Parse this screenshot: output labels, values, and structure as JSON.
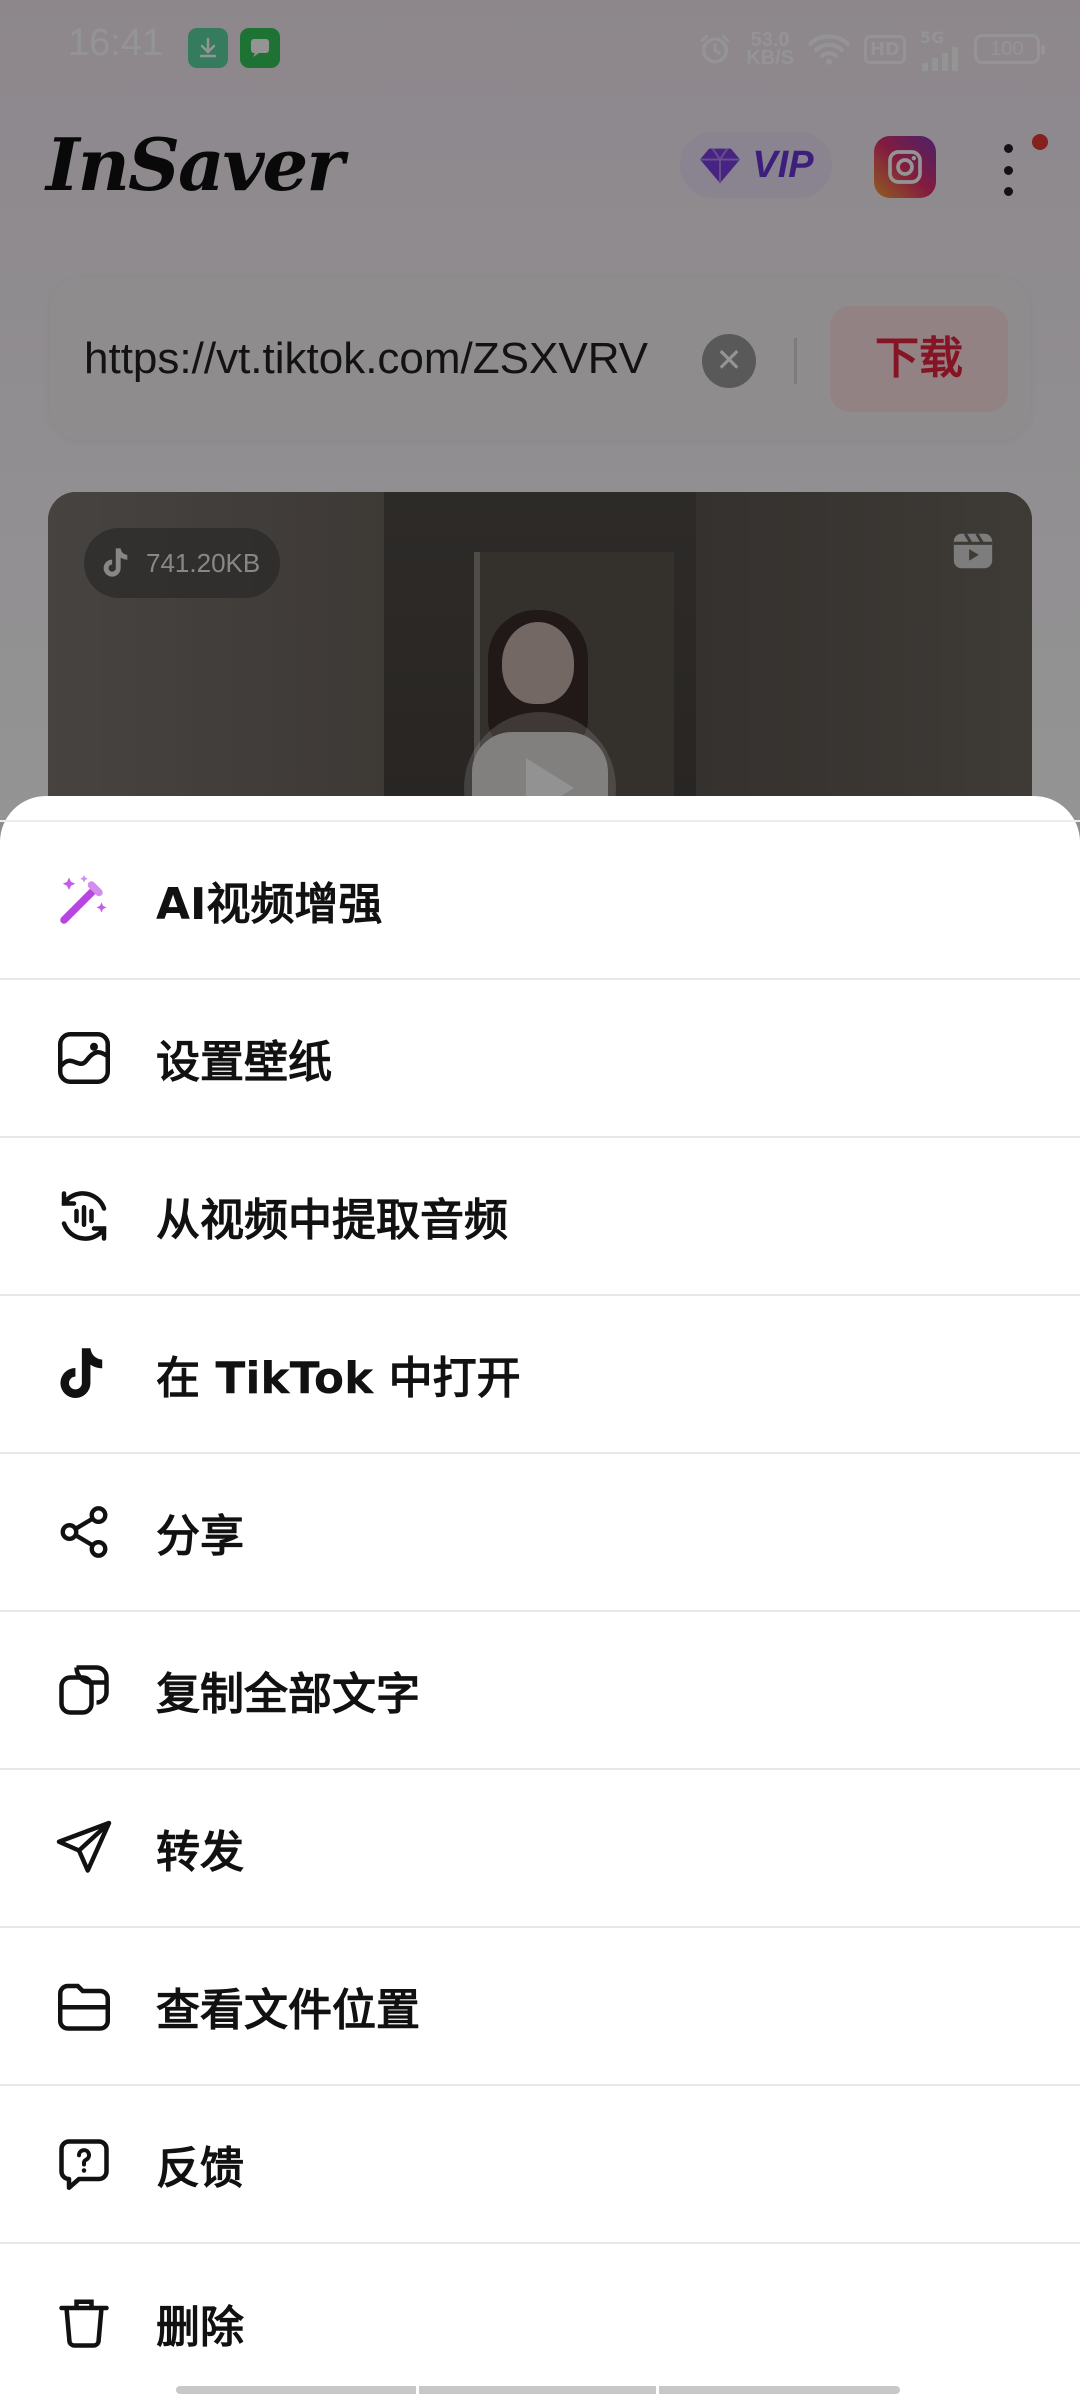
{
  "status_bar": {
    "time": "16:41",
    "speed_value": "53.0",
    "speed_unit": "KB/S",
    "hd_label": "HD",
    "network_label": "5G",
    "battery": "100"
  },
  "header": {
    "logo": "InSaver",
    "vip_label": "VIP"
  },
  "url_bar": {
    "url": "https://vt.tiktok.com/ZSXVRV",
    "download_label": "下载"
  },
  "video_card": {
    "file_size": "741.20KB"
  },
  "menu": {
    "items": [
      {
        "label": "AI视频增强",
        "icon": "magic-wand-icon"
      },
      {
        "label": "设置壁纸",
        "icon": "wallpaper-icon"
      },
      {
        "label": "从视频中提取音频",
        "icon": "extract-audio-icon"
      },
      {
        "label": "在 TikTok 中打开",
        "icon": "tiktok-icon"
      },
      {
        "label": "分享",
        "icon": "share-icon"
      },
      {
        "label": "复制全部文字",
        "icon": "copy-icon"
      },
      {
        "label": "转发",
        "icon": "send-icon"
      },
      {
        "label": "查看文件位置",
        "icon": "folder-icon"
      },
      {
        "label": "反馈",
        "icon": "feedback-icon"
      },
      {
        "label": "删除",
        "icon": "trash-icon"
      }
    ]
  },
  "colors": {
    "accent_red": "#e5233e",
    "vip_purple": "#6a35d6",
    "wand_purple": "#b845e0"
  }
}
